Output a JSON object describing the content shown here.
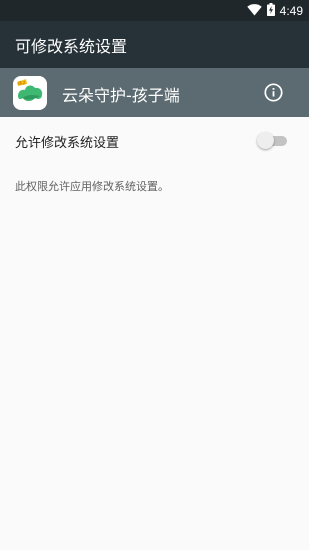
{
  "status_bar": {
    "time": "4:49",
    "icons": [
      "wifi-icon",
      "battery-charging-icon"
    ]
  },
  "app_bar": {
    "title": "可修改系统设置"
  },
  "app_header": {
    "app_name": "云朵守护-孩子端",
    "icon": "yunduo-app-icon",
    "icon_badge": "孩子",
    "info_icon": "info-icon"
  },
  "setting": {
    "label": "允许修改系统设置",
    "enabled": false
  },
  "description": "此权限允许应用修改系统设置。",
  "colors": {
    "status_bar": "#1f272b",
    "app_bar": "#263238",
    "app_header": "#5b6b71",
    "background": "#fafafa",
    "app_icon_green": "#3fb872",
    "app_icon_badge": "#f5c518"
  }
}
